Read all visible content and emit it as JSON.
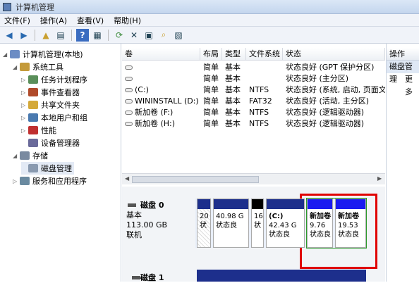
{
  "window": {
    "title": "计算机管理"
  },
  "menu": [
    "文件(F)",
    "操作(A)",
    "查看(V)",
    "帮助(H)"
  ],
  "toolbar_icons": [
    "back-icon",
    "forward-icon",
    "up-icon",
    "show-tree-icon",
    "help-icon",
    "view-icon",
    "refresh-icon",
    "delete-icon",
    "properties-icon",
    "search-icon",
    "export-icon"
  ],
  "tree": [
    {
      "label": "计算机管理(本地)",
      "level": 0,
      "arrow": "◢",
      "color": "#6b8cc4"
    },
    {
      "label": "系统工具",
      "level": 1,
      "arrow": "◢",
      "color": "#c49a3a"
    },
    {
      "label": "任务计划程序",
      "level": 2,
      "arrow": "▷",
      "color": "#5a8f5a"
    },
    {
      "label": "事件查看器",
      "level": 2,
      "arrow": "▷",
      "color": "#b04a2a"
    },
    {
      "label": "共享文件夹",
      "level": 2,
      "arrow": "▷",
      "color": "#d4a93a"
    },
    {
      "label": "本地用户和组",
      "level": 2,
      "arrow": "▷",
      "color": "#4a7ab0"
    },
    {
      "label": "性能",
      "level": 2,
      "arrow": "▷",
      "color": "#c03030"
    },
    {
      "label": "设备管理器",
      "level": 2,
      "arrow": "",
      "color": "#6a6a9a"
    },
    {
      "label": "存储",
      "level": 1,
      "arrow": "◢",
      "color": "#7a8aa0"
    },
    {
      "label": "磁盘管理",
      "level": 2,
      "arrow": "",
      "color": "#8a9ab0",
      "selected": true
    },
    {
      "label": "服务和应用程序",
      "level": 1,
      "arrow": "▷",
      "color": "#6a8aa0"
    }
  ],
  "columns": [
    "卷",
    "布局",
    "类型",
    "文件系统",
    "状态"
  ],
  "volumes": [
    {
      "name": "",
      "layout": "简单",
      "type": "基本",
      "fs": "",
      "status": "状态良好 (GPT 保护分区)"
    },
    {
      "name": "",
      "layout": "简单",
      "type": "基本",
      "fs": "",
      "status": "状态良好 (主分区)"
    },
    {
      "name": "(C:)",
      "layout": "简单",
      "type": "基本",
      "fs": "NTFS",
      "status": "状态良好 (系统, 启动, 页面文"
    },
    {
      "name": "WININSTALL (D:)",
      "layout": "简单",
      "type": "基本",
      "fs": "FAT32",
      "status": "状态良好 (活动, 主分区)"
    },
    {
      "name": "新加卷 (F:)",
      "layout": "简单",
      "type": "基本",
      "fs": "NTFS",
      "status": "状态良好 (逻辑驱动器)"
    },
    {
      "name": "新加卷 (H:)",
      "layout": "简单",
      "type": "基本",
      "fs": "NTFS",
      "status": "状态良好 (逻辑驱动器)"
    }
  ],
  "disk0": {
    "name": "磁盘 0",
    "type": "基本",
    "size": "113.00 GB",
    "state": "联机"
  },
  "disk1": {
    "name": "磁盘 1"
  },
  "partitions": [
    {
      "line1": "",
      "line2": "20",
      "line3": "状",
      "bar": "#1d2f8c"
    },
    {
      "line1": "",
      "line2": "40.98 G",
      "line3": "状态良",
      "bar": "#1d2f8c"
    },
    {
      "line1": "",
      "line2": "16",
      "line3": "状",
      "bar": "#000000"
    },
    {
      "line1": "(C:)",
      "line2": "42.43 G",
      "line3": "状态良",
      "bar": "#1d2f8c"
    },
    {
      "line1": "新加卷",
      "line2": "9.76",
      "line3": "状态良",
      "bar": "#1a1af0"
    },
    {
      "line1": "新加卷",
      "line2": "19.53",
      "line3": "状态良",
      "bar": "#1a1af0"
    }
  ],
  "actions": {
    "header": "操作",
    "selected": "磁盘管理",
    "more": "更多"
  }
}
